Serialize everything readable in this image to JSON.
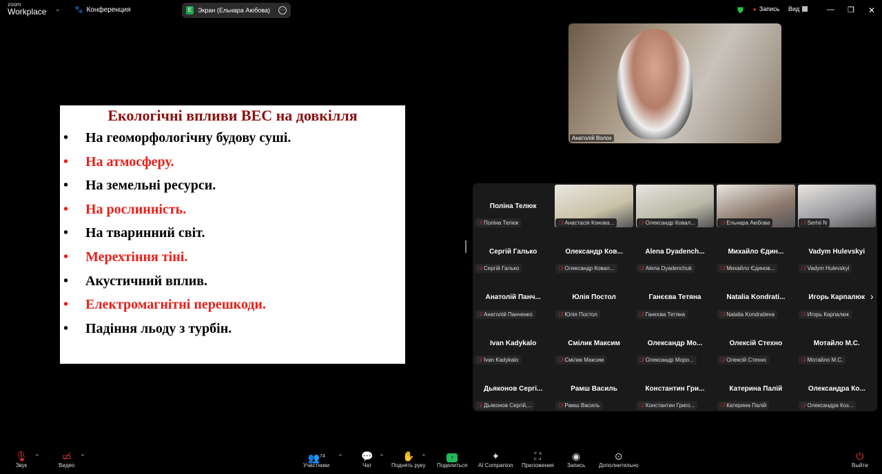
{
  "topbar": {
    "logo_small": "zoom",
    "logo_big": "Workplace",
    "meeting_label": "Конференция",
    "screen_share_label": "Экран (Ельнара Аюбова)",
    "screen_share_initial": "E",
    "record_label": "Запись",
    "view_label": "Вид"
  },
  "slide": {
    "title": "Екологічні впливи ВЕС на довкілля",
    "items": [
      {
        "text": "На геоморфологічну будову суші.",
        "color": "black"
      },
      {
        "text": "На атмосферу.",
        "color": "red"
      },
      {
        "text": "На земельні ресурси.",
        "color": "black"
      },
      {
        "text": "На рослинність.",
        "color": "red"
      },
      {
        "text": "На тваринний світ.",
        "color": "black"
      },
      {
        "text": "Мерехтіння тіні.",
        "color": "red"
      },
      {
        "text": "Акустичний вплив.",
        "color": "black"
      },
      {
        "text": "Електромагнітні перешкоди.",
        "color": "red"
      },
      {
        "text": "Падіння льоду з турбін.",
        "color": "black"
      }
    ]
  },
  "speaker": {
    "name": "Анатолій Волох"
  },
  "participants": [
    {
      "big": "Поліна Телюк",
      "small": "Поліна Телюк"
    },
    {
      "big": "",
      "small": "Анастасія Конова...",
      "video": "#c9c2a8"
    },
    {
      "big": "",
      "small": "Олександр Ковал...",
      "video": "#b9b7a6"
    },
    {
      "big": "",
      "small": "Ельнара Аюбова",
      "video": "#8d7a6e"
    },
    {
      "big": "",
      "small": "Serhii N",
      "video": "#9a9aa0"
    },
    {
      "big": "Сергій Галько",
      "small": "Сергій Галько"
    },
    {
      "big": "Олександр Ков...",
      "small": "Олександр Ковал..."
    },
    {
      "big": "Alena Dyadench...",
      "small": "Alena Dyadenchuk"
    },
    {
      "big": "Михайло Єдин...",
      "small": "Михайло Єдинов..."
    },
    {
      "big": "Vadym Hulevskyi",
      "small": "Vadym Hulevskyi"
    },
    {
      "big": "Анатолій Панч...",
      "small": "Анатолій Панченко"
    },
    {
      "big": "Юлія Постол",
      "small": "Юлія Постол"
    },
    {
      "big": "Ганєєва Тетяна",
      "small": "Ганєєва Тетяна"
    },
    {
      "big": "Natalia Kondrati...",
      "small": "Natalia Kondratieva"
    },
    {
      "big": "Игорь Карпалюк",
      "small": "Игорь Карпалюк"
    },
    {
      "big": "Ivan Kadykalo",
      "small": "Ivan Kadykalo"
    },
    {
      "big": "Смілик Максим",
      "small": "Смілик Максим"
    },
    {
      "big": "Олександр Мо...",
      "small": "Олександр Моро..."
    },
    {
      "big": "Олексій Стехно",
      "small": "Олексій Стехно"
    },
    {
      "big": "Мотайло М.С.",
      "small": "Мотайло М.С."
    },
    {
      "big": "Дьяконов Сергі...",
      "small": "Дьяконов Сергій,..."
    },
    {
      "big": "Рамш Василь",
      "small": "Рамш Василь"
    },
    {
      "big": "Константин Гри...",
      "small": "Константин Григо..."
    },
    {
      "big": "Катерина Палій",
      "small": "Катерина Палій"
    },
    {
      "big": "Олександра Ко...",
      "small": "Олександра Коз..."
    }
  ],
  "toolbar": {
    "audio": "Звук",
    "video": "Видео",
    "participants": "Участники",
    "participants_count": "74",
    "chat": "Чат",
    "raise_hand": "Поднять руку",
    "share": "Поделиться",
    "ai": "AI Companion",
    "apps": "Приложения",
    "record": "Запись",
    "more": "Дополнительно",
    "leave": "Выйти"
  }
}
